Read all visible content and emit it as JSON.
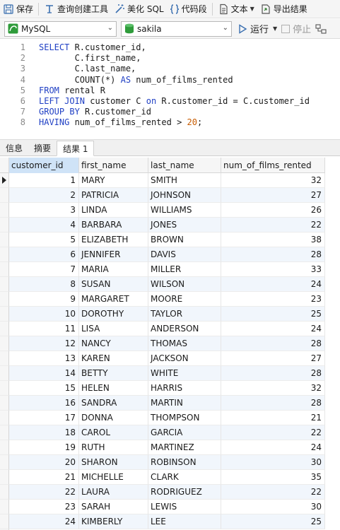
{
  "toolbar": {
    "save": "保存",
    "query_builder": "查询创建工具",
    "beautify": "美化 SQL",
    "snippet": "代码段",
    "text": "文本",
    "export": "导出结果"
  },
  "connection": {
    "server": "MySQL",
    "database": "sakila",
    "run": "运行",
    "stop": "停止"
  },
  "editor": {
    "lines": [
      {
        "n": "1",
        "parts": [
          [
            "kw",
            "SELECT "
          ],
          [
            "t",
            "R.customer_id,"
          ]
        ]
      },
      {
        "n": "2",
        "parts": [
          [
            "t",
            "       C.first_name,"
          ]
        ]
      },
      {
        "n": "3",
        "parts": [
          [
            "t",
            "       C.last_name,"
          ]
        ]
      },
      {
        "n": "4",
        "parts": [
          [
            "t",
            "       COUNT(*) "
          ],
          [
            "kw",
            "AS"
          ],
          [
            "t",
            " num_of_films_rented"
          ]
        ]
      },
      {
        "n": "5",
        "parts": [
          [
            "kw",
            "FROM"
          ],
          [
            "t",
            " rental R"
          ]
        ]
      },
      {
        "n": "6",
        "parts": [
          [
            "kw",
            "LEFT JOIN"
          ],
          [
            "t",
            " customer C "
          ],
          [
            "kw",
            "on"
          ],
          [
            "t",
            " R.customer_id = C.customer_id"
          ]
        ]
      },
      {
        "n": "7",
        "parts": [
          [
            "kw",
            "GROUP BY"
          ],
          [
            "t",
            " R.customer_id"
          ]
        ]
      },
      {
        "n": "8",
        "parts": [
          [
            "kw",
            "HAVING"
          ],
          [
            "t",
            " num_of_films_rented > "
          ],
          [
            "num",
            "20"
          ],
          [
            "t",
            ";"
          ]
        ]
      }
    ]
  },
  "tabs": [
    "信息",
    "摘要",
    "结果 1"
  ],
  "result": {
    "columns": [
      "customer_id",
      "first_name",
      "last_name",
      "num_of_films_rented"
    ],
    "rows": [
      [
        "1",
        "MARY",
        "SMITH",
        "32"
      ],
      [
        "2",
        "PATRICIA",
        "JOHNSON",
        "27"
      ],
      [
        "3",
        "LINDA",
        "WILLIAMS",
        "26"
      ],
      [
        "4",
        "BARBARA",
        "JONES",
        "22"
      ],
      [
        "5",
        "ELIZABETH",
        "BROWN",
        "38"
      ],
      [
        "6",
        "JENNIFER",
        "DAVIS",
        "28"
      ],
      [
        "7",
        "MARIA",
        "MILLER",
        "33"
      ],
      [
        "8",
        "SUSAN",
        "WILSON",
        "24"
      ],
      [
        "9",
        "MARGARET",
        "MOORE",
        "23"
      ],
      [
        "10",
        "DOROTHY",
        "TAYLOR",
        "25"
      ],
      [
        "11",
        "LISA",
        "ANDERSON",
        "24"
      ],
      [
        "12",
        "NANCY",
        "THOMAS",
        "28"
      ],
      [
        "13",
        "KAREN",
        "JACKSON",
        "27"
      ],
      [
        "14",
        "BETTY",
        "WHITE",
        "28"
      ],
      [
        "15",
        "HELEN",
        "HARRIS",
        "32"
      ],
      [
        "16",
        "SANDRA",
        "MARTIN",
        "28"
      ],
      [
        "17",
        "DONNA",
        "THOMPSON",
        "21"
      ],
      [
        "18",
        "CAROL",
        "GARCIA",
        "22"
      ],
      [
        "19",
        "RUTH",
        "MARTINEZ",
        "24"
      ],
      [
        "20",
        "SHARON",
        "ROBINSON",
        "30"
      ],
      [
        "21",
        "MICHELLE",
        "CLARK",
        "35"
      ],
      [
        "22",
        "LAURA",
        "RODRIGUEZ",
        "22"
      ],
      [
        "23",
        "SARAH",
        "LEWIS",
        "30"
      ],
      [
        "24",
        "KIMBERLY",
        "LEE",
        "25"
      ]
    ]
  },
  "colors": {
    "keyword": "#1f3fc4",
    "number": "#c75b00",
    "alt_row": "#f1f6fc",
    "selected_header": "#cfe3f7"
  }
}
